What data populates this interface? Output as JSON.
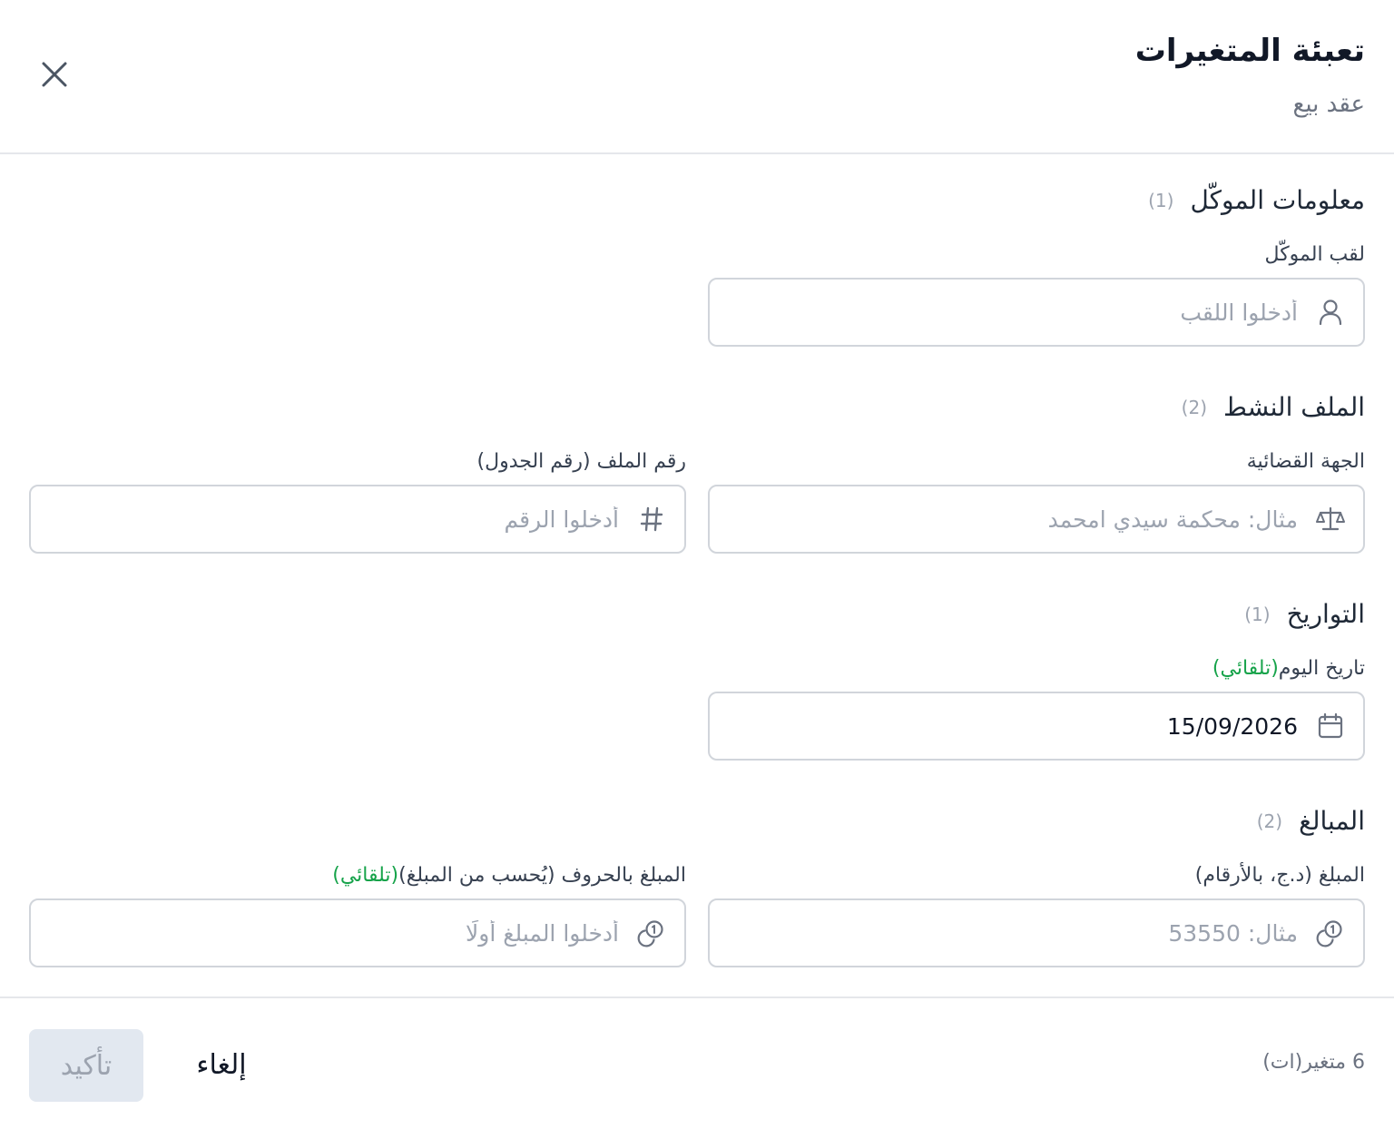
{
  "dialog": {
    "title": "تعبئة المتغيرات",
    "subtitle": "عقد بيع"
  },
  "sections": {
    "client": {
      "title": "معلومات الموكّل",
      "count": "(1)",
      "client_name_label": "لقب الموكّل",
      "client_name_placeholder": "أدخلوا اللقب"
    },
    "active_file": {
      "title": "الملف النشط",
      "count": "(2)",
      "court_label": "الجهة القضائية",
      "court_placeholder": "مثال: محكمة سيدي امحمد",
      "file_number_label": "رقم الملف (رقم الجدول)",
      "file_number_placeholder": "أدخلوا الرقم"
    },
    "dates": {
      "title": "التواريخ",
      "count": "(1)",
      "today_label": "تاريخ اليوم",
      "today_auto": "(تلقائي)",
      "today_value": "15/09/2026"
    },
    "amounts": {
      "title": "المبالغ",
      "count": "(2)",
      "amount_label": "المبلغ (د.ج، بالأرقام)",
      "amount_placeholder": "مثال: 53550",
      "amount_words_label": "المبلغ بالحروف (يُحسب من المبلغ)",
      "amount_words_auto": "(تلقائي)",
      "amount_words_placeholder": "أدخلوا المبلغ أولًا"
    }
  },
  "footer": {
    "variable_count": "6 متغير(ات)",
    "cancel_label": "إلغاء",
    "confirm_label": "تأكيد"
  },
  "icons": {
    "close": "close-icon",
    "user": "user-icon",
    "court": "scale-icon",
    "number": "hash-icon",
    "date": "calendar-icon",
    "money": "coins-icon"
  },
  "colors": {
    "auto_tag": "#16a34a",
    "confirm_disabled_bg": "#e2e8f0",
    "border": "#d1d5db"
  }
}
